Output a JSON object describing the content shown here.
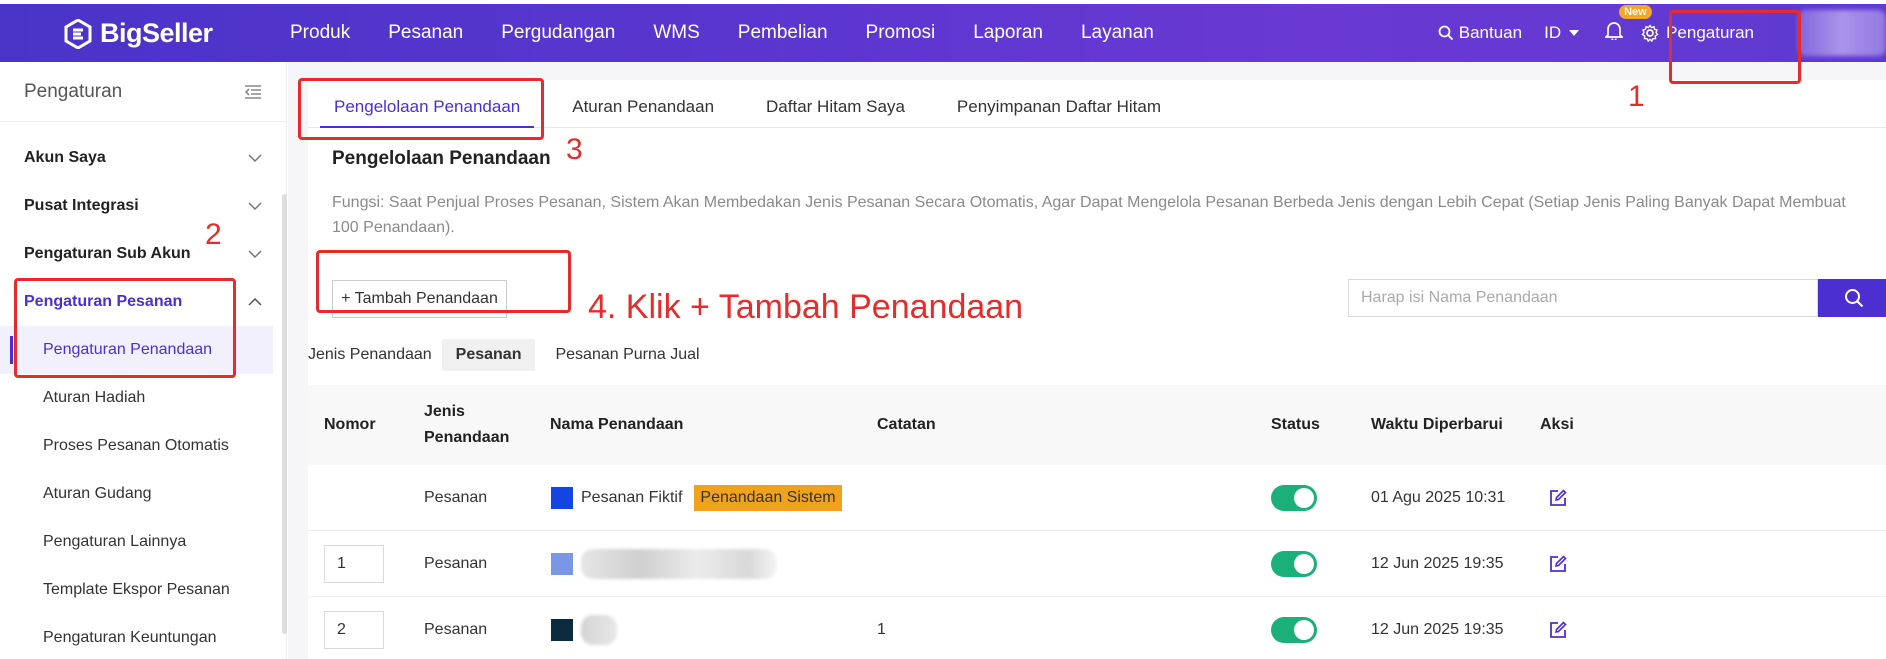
{
  "brand": {
    "name": "BigSeller"
  },
  "nav": {
    "items": [
      "Produk",
      "Pesanan",
      "Pergudangan",
      "WMS",
      "Pembelian",
      "Promosi",
      "Laporan",
      "Layanan"
    ],
    "help_label": "Bantuan",
    "lang_label": "ID",
    "new_badge": "New",
    "settings_label": "Pengaturan"
  },
  "sidebar": {
    "title": "Pengaturan",
    "groups": [
      {
        "label": "Akun Saya",
        "expanded": false
      },
      {
        "label": "Pusat Integrasi",
        "expanded": false
      },
      {
        "label": "Pengaturan Sub Akun",
        "expanded": false
      },
      {
        "label": "Pengaturan Pesanan",
        "expanded": true
      }
    ],
    "subitems": [
      {
        "label": "Pengaturan Penandaan",
        "active": true
      },
      {
        "label": "Aturan Hadiah"
      },
      {
        "label": "Proses Pesanan Otomatis"
      },
      {
        "label": "Aturan Gudang"
      },
      {
        "label": "Pengaturan Lainnya"
      },
      {
        "label": "Template Ekspor Pesanan"
      },
      {
        "label": "Pengaturan Keuntungan"
      }
    ]
  },
  "tabs": [
    "Pengelolaan Penandaan",
    "Aturan Penandaan",
    "Daftar Hitam Saya",
    "Penyimpanan Daftar Hitam"
  ],
  "main": {
    "title": "Pengelolaan Penandaan",
    "description": "Fungsi: Saat Penjual Proses Pesanan, Sistem Akan Membedakan Jenis Pesanan Secara Otomatis, Agar Dapat Mengelola Pesanan Berbeda Jenis dengan Lebih Cepat (Setiap Jenis Paling Banyak Dapat Membuat 100 Penandaan).",
    "add_button": "+ Tambah Penandaan",
    "search_placeholder": "Harap isi Nama Penandaan",
    "filter_label": "Jenis Penandaan",
    "filters": [
      "Pesanan",
      "Pesanan Purna Jual"
    ]
  },
  "table": {
    "headers": [
      "Nomor",
      "Jenis\nPenandaan",
      "Nama Penandaan",
      "Catatan",
      "Status",
      "Waktu Diperbarui",
      "Aksi"
    ],
    "rows": [
      {
        "nomor": "",
        "jenis": "Pesanan",
        "nama": "Pesanan Fiktif",
        "tag": "Penandaan Sistem",
        "catatan": "",
        "status": true,
        "waktu": "01 Agu 2025 10:31",
        "color": "#1346e0"
      },
      {
        "nomor": "1",
        "jenis": "Pesanan",
        "nama": "",
        "tag": "",
        "catatan": "",
        "status": true,
        "waktu": "12 Jun 2025 19:35",
        "color": "#7a97e6"
      },
      {
        "nomor": "2",
        "jenis": "Pesanan",
        "nama": "",
        "tag": "",
        "catatan": "1",
        "status": true,
        "waktu": "12 Jun 2025 19:35",
        "color": "#0c2a3e"
      }
    ]
  },
  "annotations": {
    "step1": "1",
    "step2": "2",
    "step3": "3",
    "step4": "4. Klik + Tambah Penandaan",
    "color": "#e52b2b"
  }
}
